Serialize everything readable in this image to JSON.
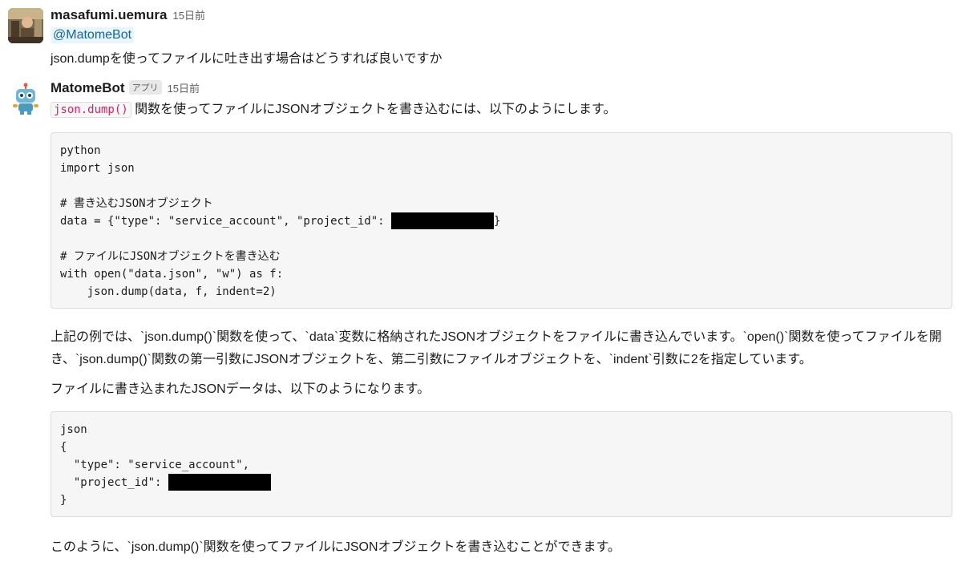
{
  "messages": [
    {
      "author": "masafumi.uemura",
      "time": "15日前",
      "mention": "@MatomeBot",
      "text": "json.dumpを使ってファイルに吐き出す場合はどうすれば良いですか"
    },
    {
      "author": "MatomeBot",
      "badge": "アプリ",
      "time": "15日前",
      "intro_code": "json.dump()",
      "intro_text": "関数を使ってファイルにJSONオブジェクトを書き込むには、以下のようにします。",
      "code1": {
        "lang": "python",
        "line1": "import json",
        "comment1": "# 書き込むJSONオブジェクト",
        "data_line_start": "data = {\"type\": \"service_account\", \"project_id\": ",
        "data_line_end": "}",
        "comment2": "# ファイルにJSONオブジェクトを書き込む",
        "with_line": "with open(\"data.json\", \"w\") as f:",
        "dump_line": "    json.dump(data, f, indent=2)"
      },
      "explanation": "上記の例では、`json.dump()`関数を使って、`data`変数に格納されたJSONオブジェクトをファイルに書き込んでいます。`open()`関数を使ってファイルを開き、`json.dump()`関数の第一引数にJSONオブジェクトを、第二引数にファイルオブジェクトを、`indent`引数に2を指定しています。",
      "result_intro": "ファイルに書き込まれたJSONデータは、以下のようになります。",
      "code2": {
        "lang": "json",
        "open": "{",
        "type_line": "  \"type\": \"service_account\",",
        "project_line": "  \"project_id\": ",
        "close": "}"
      },
      "conclusion": "このように、`json.dump()`関数を使ってファイルにJSONオブジェクトを書き込むことができます。"
    }
  ],
  "colors": {
    "mention_bg": "#e8f5fa",
    "mention_text": "#1264a3",
    "inline_code": "#e01e5a",
    "code_bg": "#f6f6f6"
  }
}
